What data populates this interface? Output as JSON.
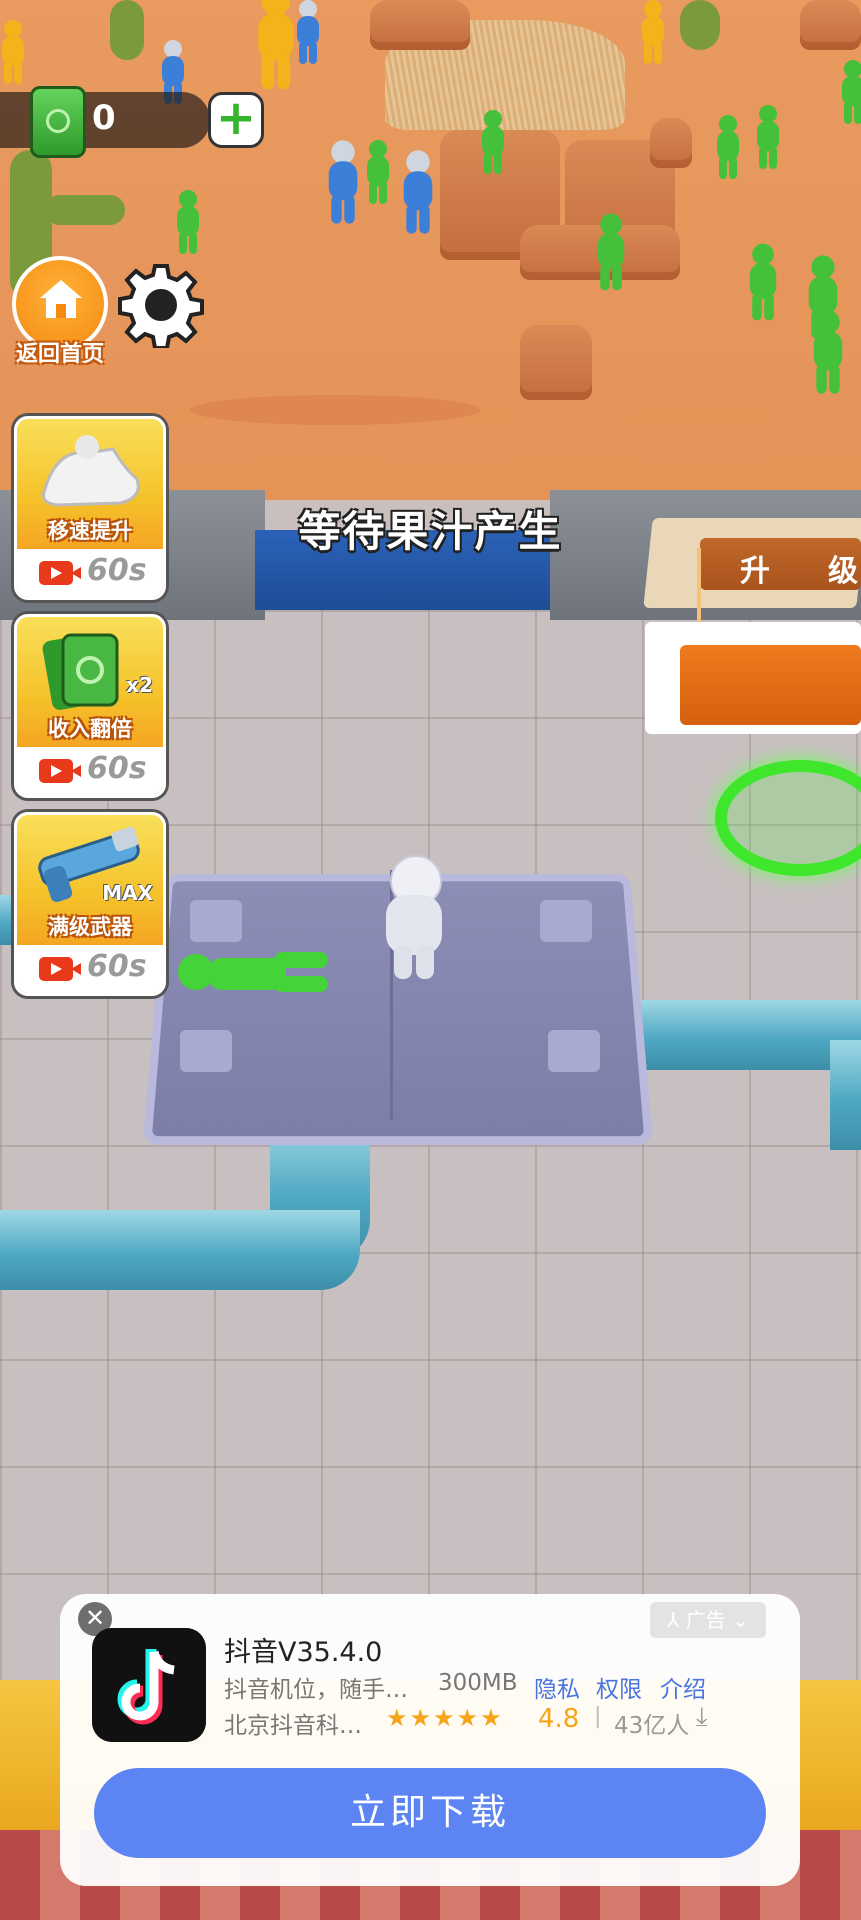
{
  "hud": {
    "money": "0",
    "add_money_symbol": "+",
    "home_label": "返回首页",
    "settings_icon": "gear-icon"
  },
  "status_text": "等待果汁产生",
  "upgrade_sign": {
    "char1": "升",
    "char2": "级"
  },
  "boosts": [
    {
      "label": "移速提升",
      "timer": "60s",
      "icon": "sneaker-icon"
    },
    {
      "label": "收入翻倍",
      "timer": "60s",
      "tag": "x2",
      "icon": "cash-stack-icon"
    },
    {
      "label": "满级武器",
      "timer": "60s",
      "tag": "MAX",
      "icon": "blaster-icon"
    }
  ],
  "ad": {
    "close_symbol": "✕",
    "badge": "广告",
    "app_name": "抖音V35.4.0",
    "description": "抖音机位，随手…",
    "size": "300MB",
    "links": [
      "隐私",
      "权限",
      "介绍"
    ],
    "developer": "北京抖音科…",
    "stars": "★★★★★",
    "rating": "4.8",
    "separator": "|",
    "installs": "43亿人",
    "download_label": "立即下载",
    "colors": {
      "button": "#5c84f2",
      "link": "#4a74e4",
      "star": "#f4a51a"
    }
  }
}
